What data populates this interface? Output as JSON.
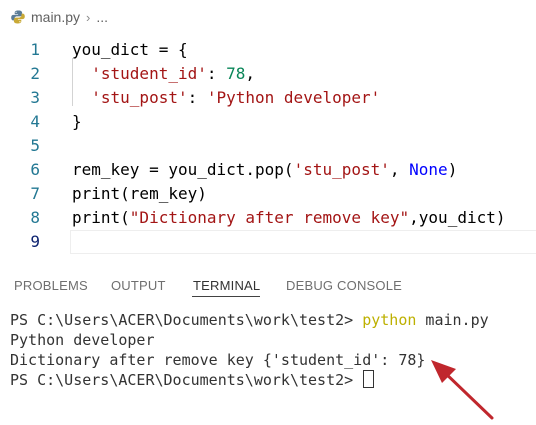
{
  "breadcrumb": {
    "file": "main.py",
    "separator": "›",
    "more": "..."
  },
  "editor": {
    "line_numbers": [
      "1",
      "2",
      "3",
      "4",
      "5",
      "6",
      "7",
      "8",
      "9"
    ],
    "lines": [
      [
        {
          "t": "you_dict = {",
          "c": "plain"
        }
      ],
      [
        {
          "t": "  ",
          "c": "plain"
        },
        {
          "t": "'student_id'",
          "c": "str"
        },
        {
          "t": ": ",
          "c": "plain"
        },
        {
          "t": "78",
          "c": "num"
        },
        {
          "t": ",",
          "c": "plain"
        }
      ],
      [
        {
          "t": "  ",
          "c": "plain"
        },
        {
          "t": "'stu_post'",
          "c": "str"
        },
        {
          "t": ": ",
          "c": "plain"
        },
        {
          "t": "'Python developer'",
          "c": "str"
        }
      ],
      [
        {
          "t": "}",
          "c": "plain"
        }
      ],
      [],
      [
        {
          "t": "rem_key = you_dict.pop(",
          "c": "plain"
        },
        {
          "t": "'stu_post'",
          "c": "str"
        },
        {
          "t": ", ",
          "c": "plain"
        },
        {
          "t": "None",
          "c": "kw"
        },
        {
          "t": ")",
          "c": "plain"
        }
      ],
      [
        {
          "t": "print(rem_key)",
          "c": "plain"
        }
      ],
      [
        {
          "t": "print(",
          "c": "plain"
        },
        {
          "t": "\"Dictionary after remove key\"",
          "c": "str"
        },
        {
          "t": ",you_dict)",
          "c": "plain"
        }
      ],
      []
    ],
    "current_line": 9
  },
  "panel": {
    "tabs": [
      "PROBLEMS",
      "OUTPUT",
      "TERMINAL",
      "DEBUG CONSOLE"
    ],
    "active_tab": "TERMINAL"
  },
  "terminal": {
    "prompt": "PS C:\\Users\\ACER\\Documents\\work\\test2> ",
    "command_name": "python",
    "command_args": " main.py",
    "output_1": "Python developer",
    "output_2": "Dictionary after remove key {'student_id': 78}",
    "prompt_2": "PS C:\\Users\\ACER\\Documents\\work\\test2> "
  },
  "colors": {
    "string": "#a31515",
    "number": "#098658",
    "keyword": "#0000ff",
    "line_number": "#237893",
    "terminal_command": "#bdb000",
    "annotation_arrow": "#c0272d"
  }
}
